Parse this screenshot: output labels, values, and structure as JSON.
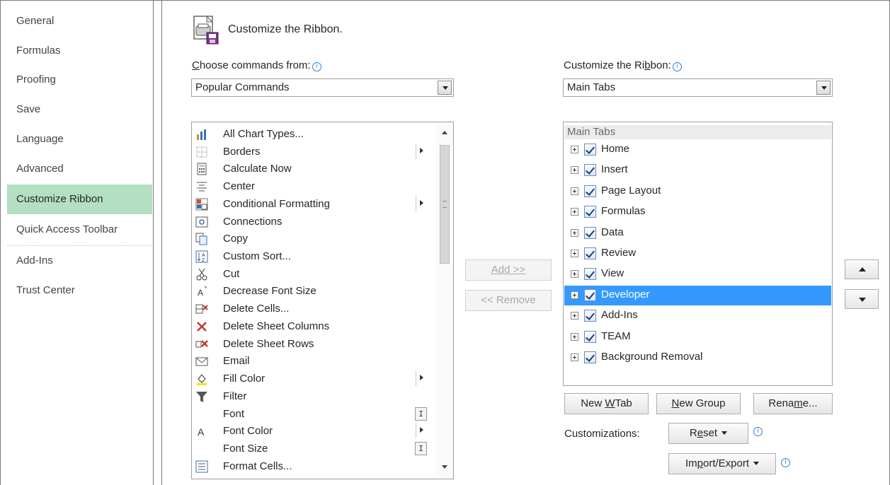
{
  "sidebar": {
    "items": [
      {
        "label": "General"
      },
      {
        "label": "Formulas"
      },
      {
        "label": "Proofing"
      },
      {
        "label": "Save"
      },
      {
        "label": "Language"
      },
      {
        "label": "Advanced"
      },
      {
        "label": "Customize Ribbon",
        "active": true
      },
      {
        "label": "Quick Access Toolbar"
      },
      {
        "label": "Add-Ins"
      },
      {
        "label": "Trust Center"
      }
    ]
  },
  "header": {
    "title": "Customize the Ribbon."
  },
  "left": {
    "label_prefix": "C",
    "label_rest": "hoose commands from:",
    "combo_value": "Popular Commands",
    "commands": [
      {
        "label": "All Chart Types...",
        "icon": "chart-icon"
      },
      {
        "label": "Borders",
        "icon": "borders-icon",
        "submenu": true
      },
      {
        "label": "Calculate Now",
        "icon": "calculator-icon"
      },
      {
        "label": "Center",
        "icon": "center-align-icon"
      },
      {
        "label": "Conditional Formatting",
        "icon": "conditional-formatting-icon",
        "submenu": true
      },
      {
        "label": "Connections",
        "icon": "connections-icon"
      },
      {
        "label": "Copy",
        "icon": "copy-icon"
      },
      {
        "label": "Custom Sort...",
        "icon": "sort-icon"
      },
      {
        "label": "Cut",
        "icon": "scissors-icon"
      },
      {
        "label": "Decrease Font Size",
        "icon": "decrease-font-icon"
      },
      {
        "label": "Delete Cells...",
        "icon": "delete-cells-icon"
      },
      {
        "label": "Delete Sheet Columns",
        "icon": "delete-columns-icon"
      },
      {
        "label": "Delete Sheet Rows",
        "icon": "delete-rows-icon"
      },
      {
        "label": "Email",
        "icon": "email-icon"
      },
      {
        "label": "Fill Color",
        "icon": "fill-color-icon",
        "submenu": true
      },
      {
        "label": "Filter",
        "icon": "filter-icon"
      },
      {
        "label": "Font",
        "icon": "",
        "ibeam": true
      },
      {
        "label": "Font Color",
        "icon": "font-color-icon",
        "submenu": true
      },
      {
        "label": "Font Size",
        "icon": "",
        "ibeam": true
      },
      {
        "label": "Format Cells...",
        "icon": "format-cells-icon"
      }
    ]
  },
  "buttons": {
    "add": "Add >>",
    "remove": "<< Remove"
  },
  "right": {
    "label_part1": "Customize the Ri",
    "label_mnemonic": "b",
    "label_part2": "bon:",
    "combo_value": "Main Tabs",
    "tree_header": "Main Tabs",
    "tabs": [
      {
        "label": "Home",
        "checked": true
      },
      {
        "label": "Insert",
        "checked": true
      },
      {
        "label": "Page Layout",
        "checked": true
      },
      {
        "label": "Formulas",
        "checked": true
      },
      {
        "label": "Data",
        "checked": true
      },
      {
        "label": "Review",
        "checked": true
      },
      {
        "label": "View",
        "checked": true
      },
      {
        "label": "Developer",
        "checked": true,
        "selected": true
      },
      {
        "label": "Add-Ins",
        "checked": true
      },
      {
        "label": "TEAM",
        "checked": true
      },
      {
        "label": "Background Removal",
        "checked": true
      }
    ],
    "new_tab_a": "New ",
    "new_tab_u": "W",
    "new_tab_b": "Tab",
    "new_group_a": "",
    "new_group_u": "N",
    "new_group_b": "ew Group",
    "rename_a": "Rena",
    "rename_u": "m",
    "rename_b": "e...",
    "customizations_label": "Customizations:",
    "reset_a": "R",
    "reset_u": "e",
    "reset_b": "set",
    "import_a": "Im",
    "import_u": "p",
    "import_b": "ort/Export"
  },
  "colors": {
    "active_nav": "#b4dfc3",
    "selection": "#3399ff",
    "info": "#2f7fd0"
  }
}
